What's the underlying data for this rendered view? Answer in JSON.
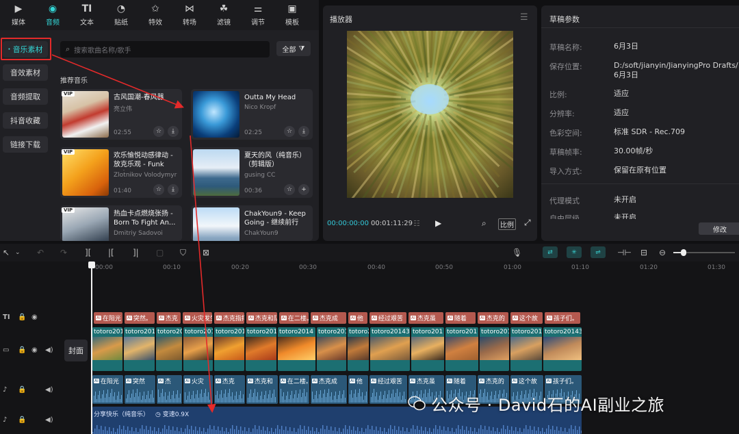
{
  "category_tabs": [
    {
      "label": "媒体",
      "icon": "media-icon"
    },
    {
      "label": "音频",
      "icon": "audio-icon",
      "active": true
    },
    {
      "label": "文本",
      "icon": "text-icon"
    },
    {
      "label": "贴纸",
      "icon": "sticker-icon"
    },
    {
      "label": "特效",
      "icon": "effects-icon"
    },
    {
      "label": "转场",
      "icon": "transition-icon"
    },
    {
      "label": "滤镜",
      "icon": "filter-icon"
    },
    {
      "label": "调节",
      "icon": "adjust-icon"
    },
    {
      "label": "模板",
      "icon": "template-icon"
    }
  ],
  "side_items": [
    "音乐素材",
    "音效素材",
    "音频提取",
    "抖音收藏",
    "链接下载"
  ],
  "search": {
    "placeholder": "搜索歌曲名称/歌手"
  },
  "filter": {
    "label": "全部"
  },
  "section_title": "推荐音乐",
  "music_cards": [
    {
      "title": "古风国潮-春风器",
      "artist": "亮立伟",
      "duration": "02:55",
      "vip": true
    },
    {
      "title": "Outta My Head",
      "artist": "Nico Kropf",
      "duration": "02:25",
      "vip": false
    },
    {
      "title": "欢乐愉悦动感律动 - 放克乐观 - Funk Upb...",
      "artist": "Zlotnikov Volodymyr",
      "duration": "01:40",
      "vip": true
    },
    {
      "title": "夏天的风（纯音乐）（剪辑版）",
      "artist": "gusing CC",
      "duration": "00:36",
      "vip": false
    },
    {
      "title": "热血卡点燃烧张扬 - Born To Fight An...",
      "artist": "Dmitriy Sadovoi",
      "duration": "",
      "vip": true
    },
    {
      "title": "ChakYoun9 - Keep Going - 继续前行",
      "artist": "ChakYoun9",
      "duration": "",
      "vip": false
    }
  ],
  "player": {
    "title": "播放器",
    "current_time": "00:00:00:00",
    "total_time": "00:01:11:29",
    "ratio_label": "比例"
  },
  "draft": {
    "title": "草稿参数",
    "rows": [
      {
        "label": "草稿名称:",
        "value": "6月3日"
      },
      {
        "label": "保存位置:",
        "value": "D:/soft/jianyin/JianyingPro Drafts/6月3日"
      },
      {
        "label": "比例:",
        "value": "适应"
      },
      {
        "label": "分辨率:",
        "value": "适应"
      },
      {
        "label": "色彩空间:",
        "value": "标准 SDR - Rec.709"
      },
      {
        "label": "草稿帧率:",
        "value": "30.00帧/秒"
      },
      {
        "label": "导入方式:",
        "value": "保留在原有位置"
      },
      {
        "label": "代理模式",
        "value": "未开启"
      },
      {
        "label": "自由层级",
        "value": "未开启"
      }
    ],
    "edit_label": "修改"
  },
  "ruler_ticks": [
    "00:00",
    "00:10",
    "00:20",
    "00:30",
    "00:40",
    "00:50",
    "01:00",
    "01:10",
    "01:20",
    "01:30"
  ],
  "cover_label": "封面",
  "text_clips": [
    "在阳光",
    "突然。",
    "杰克",
    "火灾发生",
    "杰克指挥",
    "杰克和队",
    "在二楼。",
    "杰克成",
    "他",
    "经过艰苦",
    "杰克虽",
    "随着",
    "杰克的",
    "这个故",
    "孩子们。"
  ],
  "video_clip_label": "totoro201",
  "video_clip_labels": [
    "totoro201",
    "totoro201",
    "totoro20",
    "totoro201",
    "totoro201",
    "totoro201",
    "totoro2014",
    "totoro201",
    "totoro201",
    "totoro20143",
    "totoro201",
    "totoro201",
    "totoro201",
    "totoro201",
    "totoro20143"
  ],
  "audio_clips": [
    "在阳光",
    "突然",
    "杰",
    "火灾",
    "杰克",
    "杰克和",
    "在二楼。",
    "杰克成",
    "他",
    "经过艰苦",
    "杰克虽",
    "随着",
    "杰克的",
    "这个故",
    "孩子们。"
  ],
  "music_track": {
    "label": "分享快乐（纯音乐）",
    "speed": "变速0.9X"
  },
  "watermark": "公众号 · David石的AI副业之旅"
}
